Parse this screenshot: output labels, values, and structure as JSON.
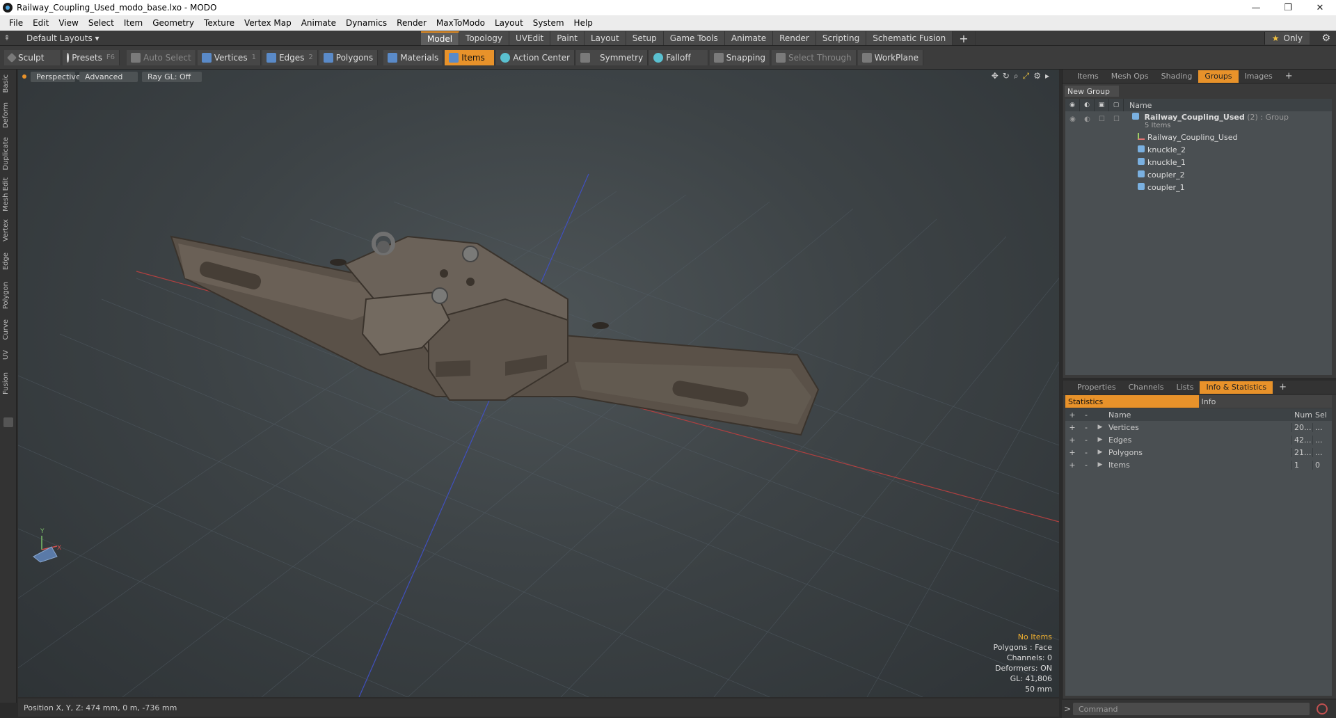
{
  "window": {
    "title": "Railway_Coupling_Used_modo_base.lxo - MODO",
    "controls": {
      "minimize": "—",
      "maximize": "❐",
      "close": "✕"
    }
  },
  "menubar": [
    "File",
    "Edit",
    "View",
    "Select",
    "Item",
    "Geometry",
    "Texture",
    "Vertex Map",
    "Animate",
    "Dynamics",
    "Render",
    "MaxToModo",
    "Layout",
    "System",
    "Help"
  ],
  "layoutbar": {
    "layout_label": "Default Layouts ▾",
    "tabs": [
      "Model",
      "Topology",
      "UVEdit",
      "Paint",
      "Layout",
      "Setup",
      "Game Tools",
      "Animate",
      "Render",
      "Scripting",
      "Schematic Fusion"
    ],
    "active_tab": "Model",
    "add_tab": "+",
    "only_star": "★",
    "only_label": "Only"
  },
  "toolbar": {
    "sculpt": "Sculpt",
    "presets": "Presets",
    "presets_key": "F6",
    "auto_select": "Auto Select",
    "vertices": "Vertices",
    "vertices_key": "1",
    "edges": "Edges",
    "edges_key": "2",
    "polygons": "Polygons",
    "materials": "Materials",
    "items": "Items",
    "action_center": "Action Center",
    "symmetry": "Symmetry",
    "falloff": "Falloff",
    "snapping": "Snapping",
    "select_through": "Select Through",
    "workplane": "WorkPlane"
  },
  "left_tabs": [
    "Basic",
    "Deform",
    "Duplicate",
    "Mesh Edit",
    "Vertex",
    "Edge",
    "Polygon",
    "Curve",
    "UV",
    "Fusion"
  ],
  "viewport": {
    "view_mode": "Perspective",
    "shading": "Advanced",
    "raygl": "Ray GL: Off",
    "stats": {
      "selection": "No Items",
      "polygons": "Polygons : Face",
      "channels": "Channels: 0",
      "deformers": "Deformers: ON",
      "gl": "GL: 41,806",
      "scale": "50 mm"
    }
  },
  "statusbar": {
    "position": "Position X, Y, Z:   474 mm, 0 m, -736 mm"
  },
  "groups_panel": {
    "tabs": [
      "Items",
      "Mesh Ops",
      "Shading",
      "Groups",
      "Images"
    ],
    "active_tab": "Groups",
    "new_group": "New Group",
    "name_header": "Name",
    "group": {
      "name": "Railway_Coupling_Used",
      "count": "(2)",
      "type": ": Group",
      "items_count": "5 Items"
    },
    "children": [
      {
        "name": "Railway_Coupling_Used",
        "icon": "locator-icon"
      },
      {
        "name": "knuckle_2",
        "icon": "mesh-icon"
      },
      {
        "name": "knuckle_1",
        "icon": "mesh-icon"
      },
      {
        "name": "coupler_2",
        "icon": "mesh-icon"
      },
      {
        "name": "coupler_1",
        "icon": "mesh-icon"
      }
    ]
  },
  "stats_panel": {
    "tabs": [
      "Properties",
      "Channels",
      "Lists",
      "Info & Statistics"
    ],
    "active_tab": "Info & Statistics",
    "subtabs": [
      "Statistics",
      "Info"
    ],
    "headers": {
      "name": "Name",
      "num": "Num",
      "sel": "Sel"
    },
    "rows": [
      {
        "name": "Vertices",
        "num": "20...",
        "sel": "..."
      },
      {
        "name": "Edges",
        "num": "42...",
        "sel": "..."
      },
      {
        "name": "Polygons",
        "num": "21...",
        "sel": "..."
      },
      {
        "name": "Items",
        "num": "1",
        "sel": "0"
      }
    ]
  },
  "command": {
    "placeholder": "Command",
    "prompt": ">"
  },
  "colors": {
    "accent": "#e8922a",
    "viewport_bg": "#3d4346",
    "panel_bg": "#4a4f52"
  }
}
